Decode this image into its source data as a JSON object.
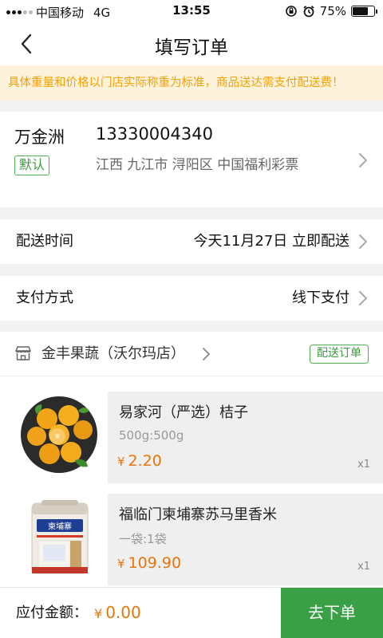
{
  "status_bar": {
    "carrier": "中国移动",
    "network": "4G",
    "time": "13:55",
    "battery": "75%",
    "battery_level": 0.75
  },
  "nav": {
    "title": "填写订单"
  },
  "notice": "具体重量和价格以门店实际称重为标准，商品送达需支付配送费！",
  "address": {
    "name": "万金洲",
    "phone": "13330004340",
    "tag": "默认",
    "detail": "江西 九江市 浔阳区 中国福利彩票"
  },
  "delivery_time": {
    "label": "配送时间",
    "value": "今天11月27日 立即配送"
  },
  "payment": {
    "label": "支付方式",
    "value": "线下支付"
  },
  "shop": {
    "name": "金丰果蔬（沃尔玛店）",
    "tag": "配送订单"
  },
  "products": [
    {
      "name": "易家河（严选）桔子",
      "spec": "500g:500g",
      "currency": "¥",
      "price": "2.20",
      "qty": "x1"
    },
    {
      "name": "福临门柬埔寨苏马里香米",
      "spec": "一袋:1袋",
      "currency": "¥",
      "price": "109.90",
      "qty": "x1",
      "package_text": "柬埔寨"
    }
  ],
  "footer": {
    "total_label": "应付金额：",
    "currency": "¥",
    "total": "0.00",
    "submit_label": "去下单"
  },
  "colors": {
    "accent_green": "#3aa045",
    "price_orange": "#e8740c",
    "notice_text": "#f4a000",
    "notice_bg": "#fdf3dd"
  },
  "icons": {
    "back": "chevron-left-icon",
    "row_arrow": "chevron-right-icon",
    "shop": "store-icon"
  }
}
